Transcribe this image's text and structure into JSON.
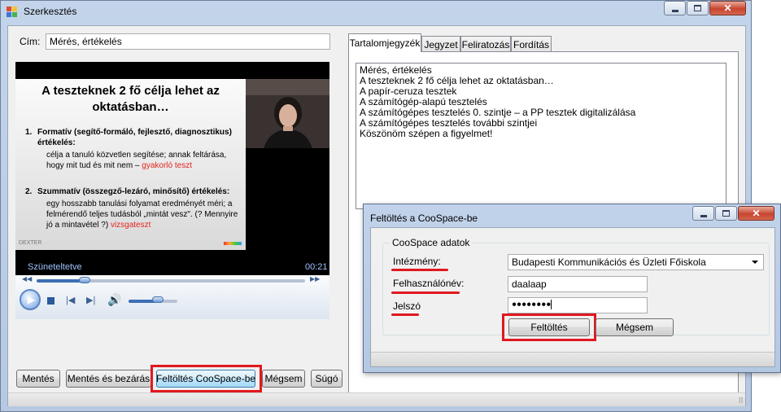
{
  "main_window": {
    "title": "Szerkesztés",
    "cim_label": "Cím:",
    "cim_value": "Mérés, értékelés",
    "buttons": {
      "save": "Mentés",
      "save_close": "Mentés és bezárás",
      "upload": "Feltöltés CooSpace-be",
      "cancel": "Mégsem",
      "help": "Súgó"
    }
  },
  "video": {
    "slide_title": "A teszteknek 2 fő célja lehet az oktatásban…",
    "item1_title": "Formatív (segítő-formáló, fejlesztő, diagnosztikus) értékelés:",
    "item1_body": "célja a tanuló közvetlen segítése; annak feltárása, hogy mit tud és mit nem –",
    "item1_highlight": "gyakorló teszt",
    "item2_title": "Szummatív (összegző-lezáró, minősítő) értékelés:",
    "item2_body": "egy hosszabb tanulási folyamat eredményét méri; a felmérendő teljes tudásból „mintát vesz\". (? Mennyire jó a mintavétel ?)",
    "item2_highlight": "vizsgateszt",
    "num1": "1.",
    "num2": "2.",
    "watermark": "DEXTER",
    "status": "Szüneteltetve",
    "time": "00:21",
    "progress_fraction": 0.18,
    "volume_fraction": 0.6
  },
  "tabs": [
    {
      "label": "Tartalomjegyzék",
      "active": true
    },
    {
      "label": "Jegyzet",
      "active": false
    },
    {
      "label": "Feliratozás",
      "active": false
    },
    {
      "label": "Fordítás",
      "active": false
    }
  ],
  "toc": [
    "Mérés, értékelés",
    "A teszteknek 2 fő célja lehet az oktatásban…",
    "A papír-ceruza tesztek",
    "A számítógép-alapú tesztelés",
    "A számítógépes tesztelés 0. szintje – a PP tesztek digitalizálása",
    "A számítógépes tesztelés további szintjei",
    "Köszönöm szépen a figyelmet!"
  ],
  "dialog": {
    "title": "Feltöltés a CooSpace-be",
    "group_title": "CooSpace adatok",
    "institution_label": "Intézmény:",
    "institution_value": "Budapesti Kommunikációs és Üzleti Főiskola",
    "username_label": "Felhasználónév:",
    "username_value": "daalaap",
    "password_label": "Jelszó",
    "password_value": "●●●●●●●●",
    "upload_button": "Feltöltés",
    "cancel_button": "Mégsem"
  },
  "colors": {
    "highlight": "#e0181f",
    "accent": "#3c6fb3",
    "status_text": "#9fc3ff"
  }
}
